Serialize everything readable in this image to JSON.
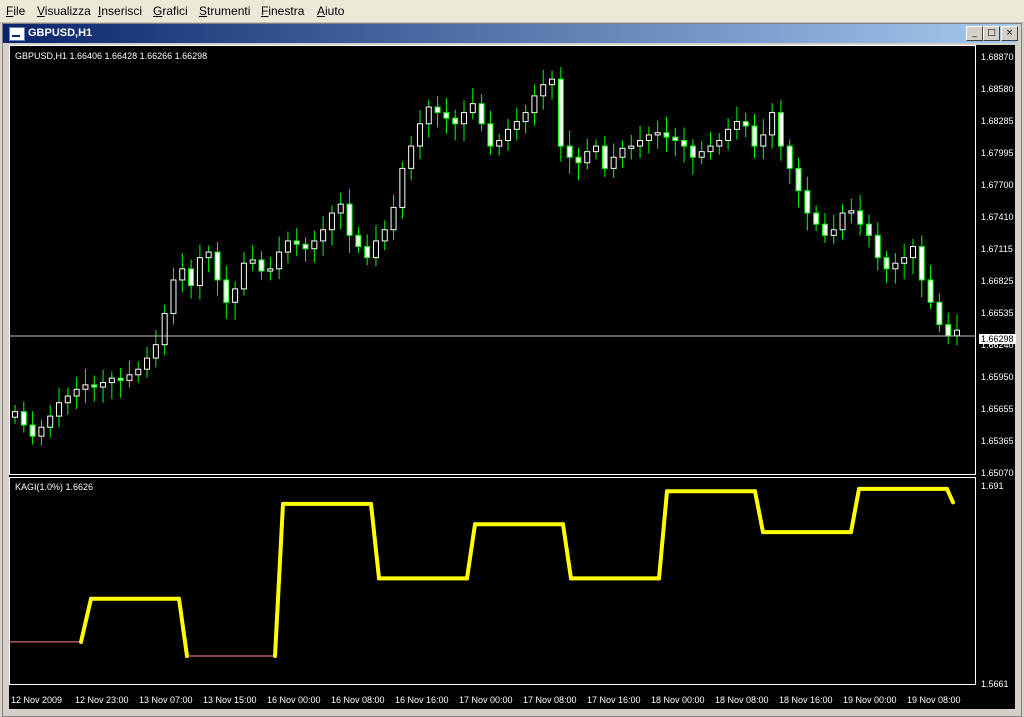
{
  "menu": [
    "File",
    "Visualizza",
    "Inserisci",
    "Grafici",
    "Strumenti",
    "Finestra",
    "Aiuto"
  ],
  "window": {
    "title": "GBPUSD,H1",
    "buttons": {
      "minimize": "_",
      "restore": "□",
      "close": "×"
    }
  },
  "main_chart": {
    "info": "GBPUSD,H1  1.66406 1.66428 1.66266 1.66298",
    "price_labels": [
      "1.68870",
      "1.68580",
      "1.68285",
      "1.67995",
      "1.67700",
      "1.67410",
      "1.67115",
      "1.66825",
      "1.66535",
      "1.66240",
      "1.65950",
      "1.65655",
      "1.65365",
      "1.65070"
    ],
    "current_price": "1.66298",
    "colors": {
      "bull": "#ffffff",
      "bear": "#ffffff",
      "wick": "#00ff00",
      "price_line": "#c0c0c0"
    }
  },
  "indicator": {
    "info": "KAGI(1.0%) 1.6626",
    "top_label": "1.691",
    "bottom_label": "1.5661",
    "colors": {
      "yang": "#ffff00",
      "yin": "#ff8080"
    }
  },
  "time_labels": [
    "12 Nov 2009",
    "12 Nov 23:00",
    "13 Nov 07:00",
    "13 Nov 15:00",
    "16 Nov 00:00",
    "16 Nov 08:00",
    "16 Nov 16:00",
    "17 Nov 00:00",
    "17 Nov 08:00",
    "17 Nov 16:00",
    "18 Nov 00:00",
    "18 Nov 08:00",
    "18 Nov 16:00",
    "19 Nov 00:00",
    "19 Nov 08:00"
  ],
  "chart_data": [
    {
      "type": "candlestick",
      "title": "GBPUSD,H1",
      "ylim": [
        1.6507,
        1.6887
      ],
      "close_series": [
        1.6562,
        1.655,
        1.654,
        1.6548,
        1.6558,
        1.657,
        1.6576,
        1.6582,
        1.6586,
        1.6584,
        1.6588,
        1.6592,
        1.659,
        1.6595,
        1.66,
        1.661,
        1.6622,
        1.665,
        1.668,
        1.669,
        1.6675,
        1.67,
        1.6705,
        1.668,
        1.666,
        1.6672,
        1.6695,
        1.6698,
        1.6688,
        1.669,
        1.6705,
        1.6715,
        1.6712,
        1.6708,
        1.6715,
        1.6725,
        1.674,
        1.6748,
        1.672,
        1.671,
        1.67,
        1.6715,
        1.6725,
        1.6745,
        1.678,
        1.68,
        1.682,
        1.6835,
        1.683,
        1.6825,
        1.682,
        1.683,
        1.6838,
        1.682,
        1.68,
        1.6805,
        1.6815,
        1.6822,
        1.683,
        1.6845,
        1.6855,
        1.686,
        1.68,
        1.679,
        1.6785,
        1.6795,
        1.68,
        1.678,
        1.679,
        1.6798,
        1.68,
        1.6805,
        1.681,
        1.6812,
        1.6808,
        1.6805,
        1.68,
        1.679,
        1.6795,
        1.68,
        1.6805,
        1.6815,
        1.6822,
        1.6818,
        1.68,
        1.681,
        1.683,
        1.68,
        1.678,
        1.676,
        1.674,
        1.673,
        1.672,
        1.6725,
        1.674,
        1.6742,
        1.673,
        1.672,
        1.67,
        1.669,
        1.6695,
        1.67,
        1.671,
        1.668,
        1.666,
        1.664,
        1.663,
        1.6635
      ],
      "last": {
        "open": 1.66406,
        "high": 1.66428,
        "low": 1.66266,
        "close": 1.66298
      }
    },
    {
      "type": "line",
      "title": "KAGI(1.0%)",
      "current": 1.6626,
      "ylim": [
        1.5661,
        1.691
      ],
      "segments": [
        {
          "level_a": 1.591,
          "level_b": 1.591
        },
        {
          "level_a": 1.6185,
          "level_b": 1.6185
        },
        {
          "level_a": 1.582,
          "level_b": 1.582
        },
        {
          "level_a": 1.679,
          "level_b": 1.679
        },
        {
          "level_a": 1.6315,
          "level_b": 1.6315
        },
        {
          "level_a": 1.666,
          "level_b": 1.666
        },
        {
          "level_a": 1.6315,
          "level_b": 1.6315
        },
        {
          "level_a": 1.687,
          "level_b": 1.687
        },
        {
          "level_a": 1.661,
          "level_b": 1.661
        },
        {
          "level_a": 1.6885,
          "level_b": 1.6885
        },
        {
          "level_a": 1.68,
          "level_b": 1.68
        }
      ]
    }
  ]
}
